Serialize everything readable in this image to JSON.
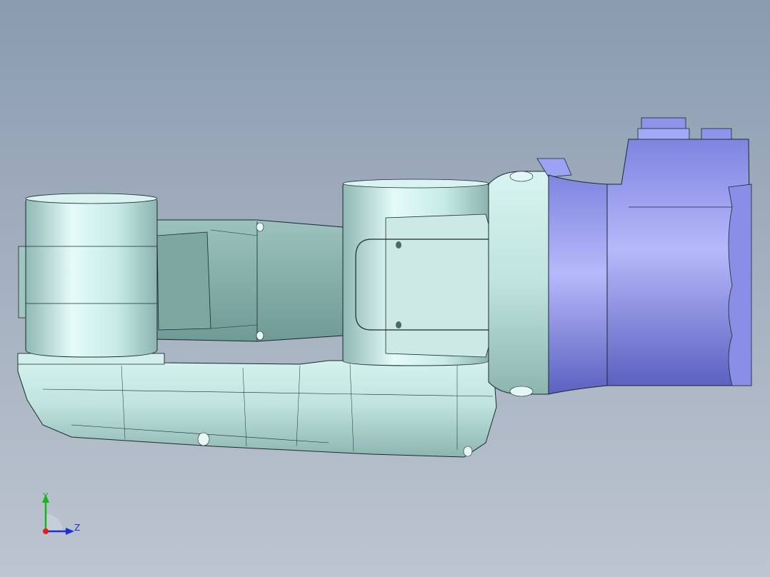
{
  "viewport": {
    "model": "robot-arm-assembly",
    "background_top": "#8a9bb0",
    "background_bottom": "#bcc5d0"
  },
  "colors": {
    "arm_body": "#bfe7e2",
    "arm_shadow": "#8fb8b4",
    "motor_body": "#9a9ff0",
    "motor_shadow": "#6d70c8",
    "edge": "#1a2a2a"
  },
  "triad": {
    "y_label": "Y",
    "z_label": "Z",
    "x_color": "#e02020",
    "y_color": "#20b020",
    "z_color": "#2030d0"
  }
}
